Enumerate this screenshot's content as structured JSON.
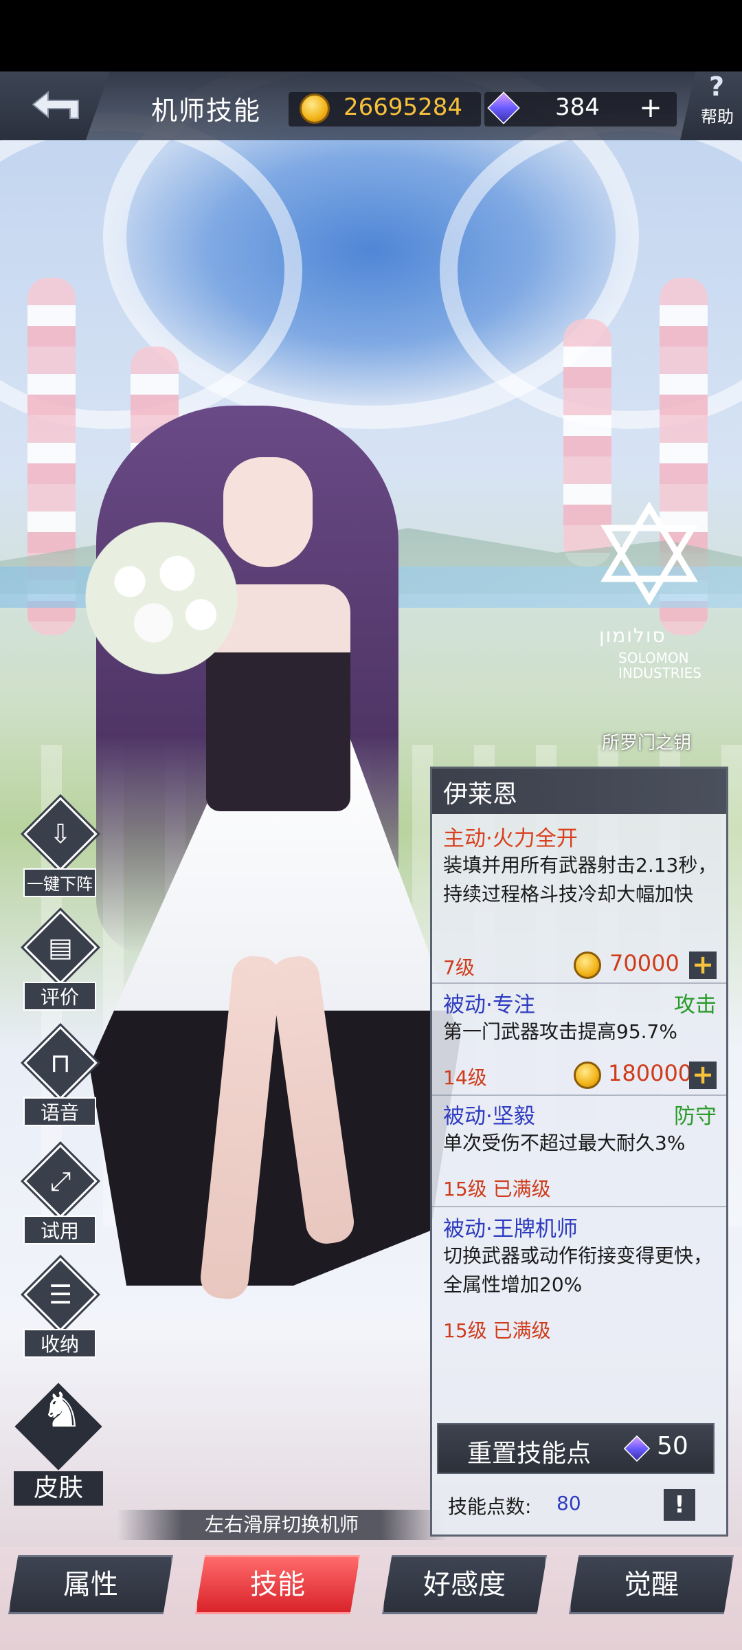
{
  "header": {
    "title": "机师技能",
    "coins": "26695284",
    "gems": "384",
    "plus": "+",
    "help_symbol": "?",
    "help_label": "帮助"
  },
  "brand": {
    "hebrew": "סולומון",
    "line1": "SOLOMON",
    "line2": "INDUSTRIES",
    "skin_name": "所罗门之钥"
  },
  "side_buttons": [
    {
      "label": "一键下阵",
      "icon": "download-icon"
    },
    {
      "label": "评价",
      "icon": "comment-icon"
    },
    {
      "label": "语音",
      "icon": "chair-icon"
    },
    {
      "label": "试用",
      "icon": "trial-icon"
    },
    {
      "label": "收纳",
      "icon": "storage-icon"
    }
  ],
  "skin": {
    "label": "皮肤",
    "icon": "rabbit-icon"
  },
  "swipe_hint": "左右滑屏切换机师",
  "panel": {
    "pilot_name": "伊莱恩",
    "skills": [
      {
        "name": "主动·火力全开",
        "kind": "active",
        "tag": "",
        "desc": "装填并用所有武器射击2.13秒，持续过程格斗技冷却大幅加快",
        "level": "7级",
        "cost": "70000",
        "upgrade": "+"
      },
      {
        "name": "被动·专注",
        "kind": "passive",
        "tag": "攻击",
        "desc": "第一门武器攻击提高95.7%",
        "level": "14级",
        "cost": "180000",
        "upgrade": "+"
      },
      {
        "name": "被动·坚毅",
        "kind": "passive",
        "tag": "防守",
        "desc": "单次受伤不超过最大耐久3%",
        "level": "15级 已满级"
      },
      {
        "name": "被动·王牌机师",
        "kind": "passive",
        "tag": "",
        "desc": "切换武器或动作衔接变得更快，全属性增加20%",
        "level": "15级 已满级"
      }
    ],
    "reset_label": "重置技能点",
    "reset_cost": "50",
    "points_label": "技能点数:",
    "points_value": "80",
    "info_symbol": "!"
  },
  "tabs": [
    {
      "label": "属性",
      "active": false
    },
    {
      "label": "技能",
      "active": true
    },
    {
      "label": "好感度",
      "active": false
    },
    {
      "label": "觉醒",
      "active": false
    }
  ],
  "colors": {
    "active_skill": "#d9401e",
    "passive_skill": "#2e3bbf",
    "tag_green": "#2a9a2a",
    "level_red": "#cf3b1a",
    "active_tab": "#d8232a"
  }
}
